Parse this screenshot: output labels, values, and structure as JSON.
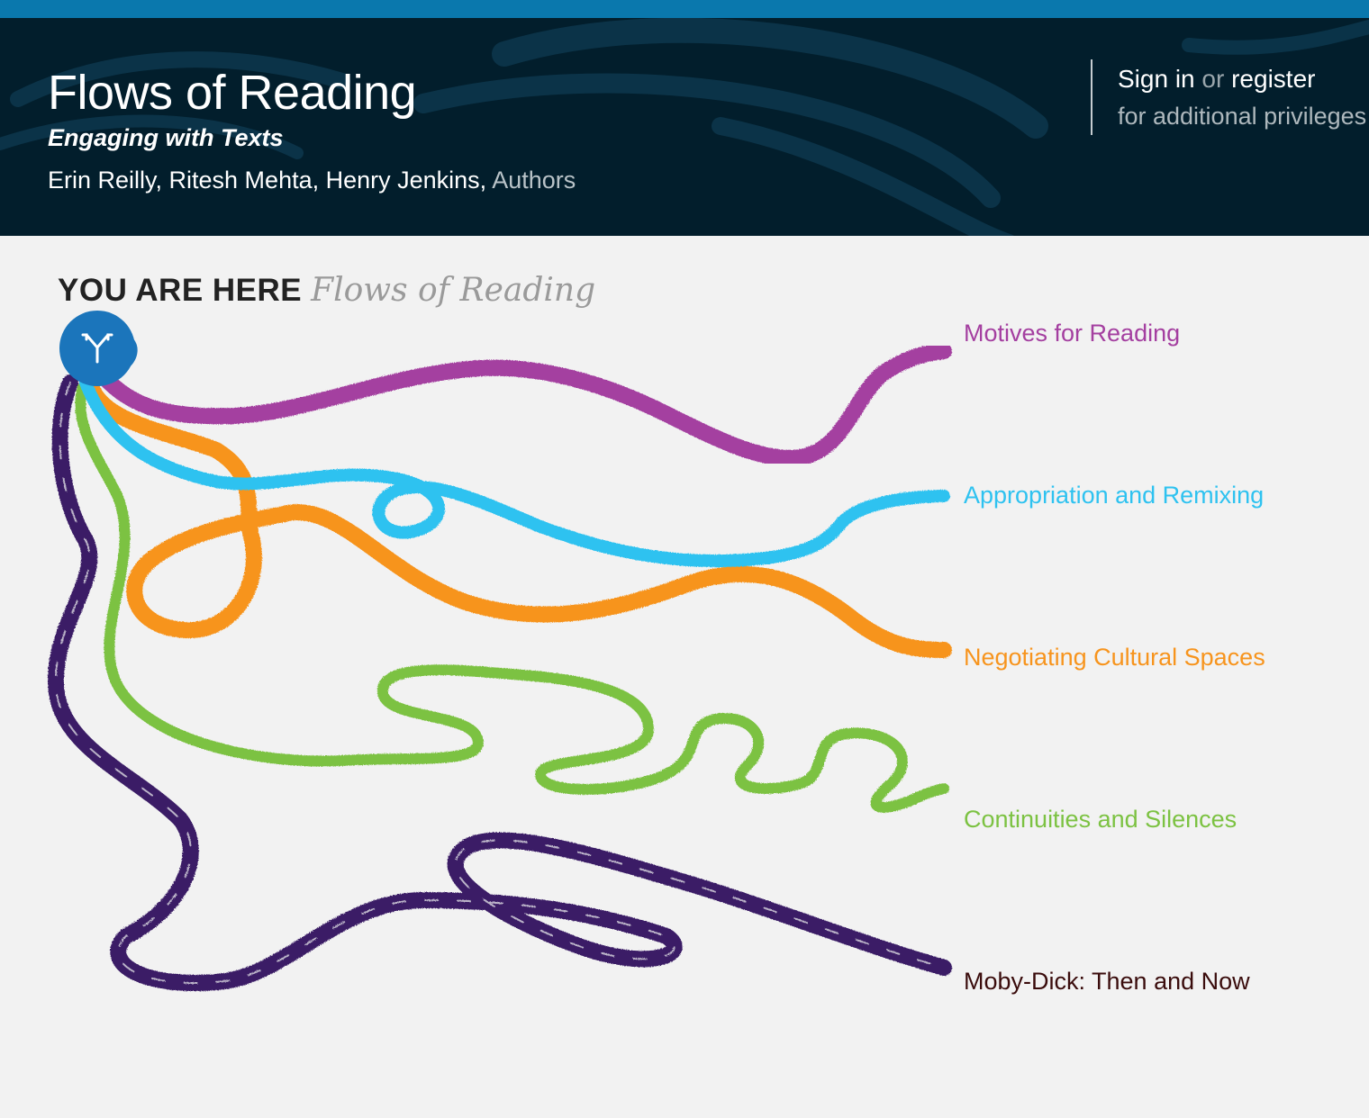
{
  "header": {
    "title": "Flows of Reading",
    "subtitle": "Engaging with Texts",
    "authors": "Erin Reilly, Ritesh Mehta, Henry Jenkins,",
    "authors_role": "Authors"
  },
  "auth": {
    "sign_in": "Sign in",
    "or": "or",
    "register": "register",
    "privileges": "for additional privileges"
  },
  "location": {
    "label": "YOU ARE HERE",
    "place": "Flows of Reading",
    "icon": "fork-arrows-icon"
  },
  "paths": [
    {
      "label": "Motives for Reading",
      "color": "#a43fa0"
    },
    {
      "label": "Appropriation and Remixing",
      "color": "#2ec2f0"
    },
    {
      "label": "Negotiating Cultural Spaces",
      "color": "#f7941d"
    },
    {
      "label": "Continuities and Silences",
      "color": "#7cc242"
    },
    {
      "label": "Moby-Dick: Then and Now",
      "color": "#3a1f66"
    }
  ],
  "colors": {
    "topbar": "#0a78ad",
    "header_bg": "#021e2c",
    "hub": "#1b75bb",
    "moby_label": "#3a0c0c"
  }
}
